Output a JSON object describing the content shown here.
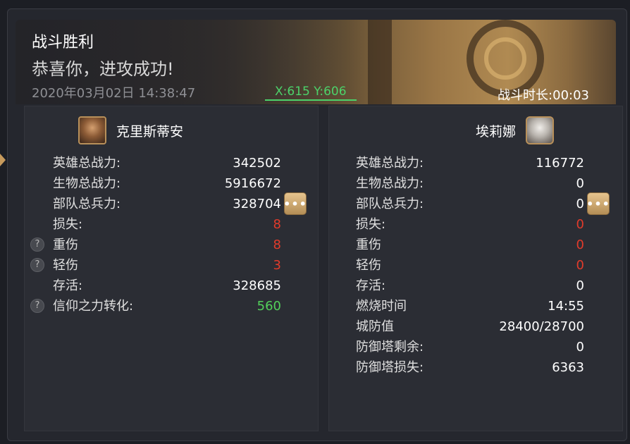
{
  "header": {
    "title": "战斗胜利",
    "subtitle": "恭喜你，进攻成功!",
    "timestamp": "2020年03月02日 14:38:47",
    "coords": "X:615 Y:606",
    "duration_label": "战斗时长:",
    "duration_value": "00:03"
  },
  "attacker": {
    "name": "克里斯蒂安",
    "avatar_icon": "warrior-portrait",
    "stats": [
      {
        "label": "英雄总战力:",
        "value": "342502"
      },
      {
        "label": "生物总战力:",
        "value": "5916672"
      },
      {
        "label": "部队总兵力:",
        "value": "328704"
      },
      {
        "label": "损失:",
        "value": "8"
      },
      {
        "label": "重伤",
        "value": "8"
      },
      {
        "label": "轻伤",
        "value": "3"
      },
      {
        "label": "存活:",
        "value": "328685"
      },
      {
        "label": "信仰之力转化:",
        "value": "560"
      }
    ]
  },
  "defender": {
    "name": "埃莉娜",
    "avatar_icon": "elf-portrait",
    "stats": [
      {
        "label": "英雄总战力:",
        "value": "116772"
      },
      {
        "label": "生物总战力:",
        "value": "0"
      },
      {
        "label": "部队总兵力:",
        "value": "0"
      },
      {
        "label": "损失:",
        "value": "0"
      },
      {
        "label": "重伤",
        "value": "0"
      },
      {
        "label": "轻伤",
        "value": "0"
      },
      {
        "label": "存活:",
        "value": "0"
      },
      {
        "label": "燃烧时间",
        "value": "14:55"
      },
      {
        "label": "城防值",
        "value": "28400/28700"
      },
      {
        "label": "防御塔剩余:",
        "value": "0"
      },
      {
        "label": "防御塔损失:",
        "value": "6363"
      }
    ]
  },
  "ui": {
    "more_glyph": "•••",
    "help_glyph": "?"
  },
  "colors": {
    "loss": "#e23b2b",
    "gain": "#52d05a",
    "coords": "#4cd26a",
    "accent": "#c69a5c"
  }
}
